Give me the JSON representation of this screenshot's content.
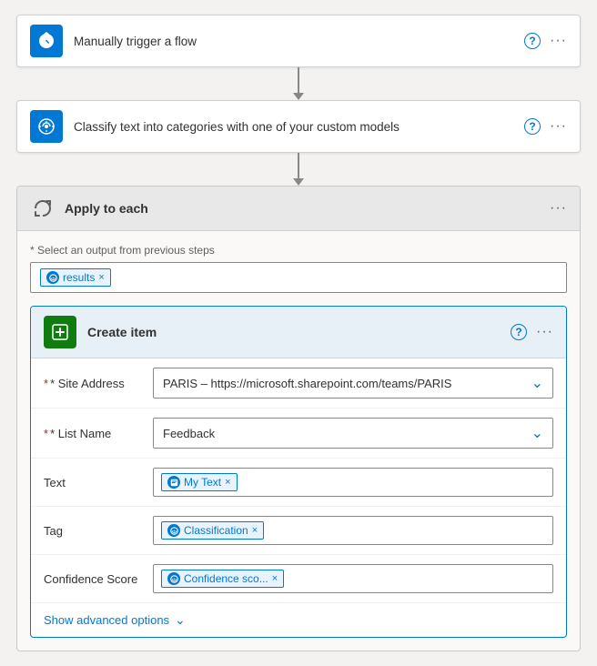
{
  "steps": {
    "trigger": {
      "title": "Manually trigger a flow",
      "icon_type": "blue",
      "help": "?",
      "more": "···"
    },
    "classify": {
      "title": "Classify text into categories with one of your custom models",
      "icon_type": "blue",
      "help": "?",
      "more": "···"
    }
  },
  "apply_each": {
    "title": "Apply to each",
    "more": "···",
    "select_label": "* Select an output from previous steps",
    "token": {
      "text": "results",
      "close": "×"
    }
  },
  "create_item": {
    "title": "Create item",
    "help": "?",
    "more": "···",
    "fields": {
      "site_address": {
        "label": "* Site Address",
        "value": "PARIS – https://microsoft.sharepoint.com/teams/PARIS"
      },
      "list_name": {
        "label": "* List Name",
        "value": "Feedback"
      },
      "text": {
        "label": "Text",
        "token_text": "My Text",
        "token_close": "×"
      },
      "tag": {
        "label": "Tag",
        "token_text": "Classification",
        "token_close": "×"
      },
      "confidence_score": {
        "label": "Confidence Score",
        "token_text": "Confidence sco...",
        "token_close": "×"
      }
    },
    "show_advanced": "Show advanced options"
  }
}
